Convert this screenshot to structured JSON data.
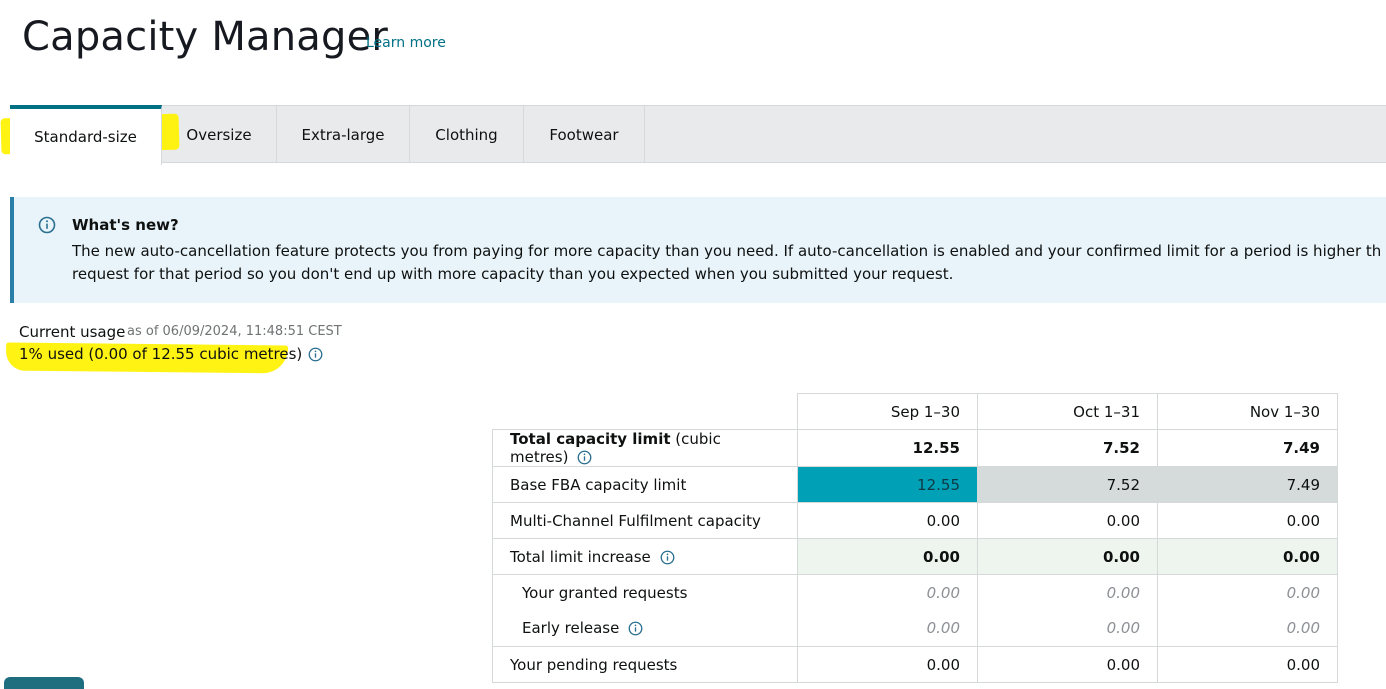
{
  "header": {
    "title": "Capacity Manager",
    "learn_more": "Learn more"
  },
  "tabs": [
    {
      "label": "Standard-size",
      "active": true
    },
    {
      "label": "Oversize",
      "active": false
    },
    {
      "label": "Extra-large",
      "active": false
    },
    {
      "label": "Clothing",
      "active": false
    },
    {
      "label": "Footwear",
      "active": false
    }
  ],
  "info": {
    "heading": "What's new?",
    "line1": "The new auto-cancellation feature protects you from paying for more capacity than you need. If auto-cancellation is enabled and your confirmed limit for a period is higher than estimat",
    "line2": "request for that period so you don't end up with more capacity than you expected when you submitted your request."
  },
  "usage": {
    "label": "Current usage",
    "as_of": "as of 06/09/2024, 11:48:51 CEST",
    "value": "1% used (0.00 of 12.55 cubic metres)"
  },
  "table": {
    "periods": [
      "Sep 1–30",
      "Oct 1–31",
      "Nov 1–30"
    ],
    "rows": {
      "total": {
        "label": "Total capacity limit",
        "unit": "(cubic metres)",
        "values": [
          "12.55",
          "7.52",
          "7.49"
        ]
      },
      "base": {
        "label": "Base FBA capacity limit",
        "values": [
          "12.55",
          "7.52",
          "7.49"
        ]
      },
      "mcf": {
        "label": "Multi-Channel Fulfilment capacity",
        "values": [
          "0.00",
          "0.00",
          "0.00"
        ]
      },
      "increase": {
        "label": "Total limit increase",
        "values": [
          "0.00",
          "0.00",
          "0.00"
        ]
      },
      "granted": {
        "label": "Your granted requests",
        "values": [
          "0.00",
          "0.00",
          "0.00"
        ]
      },
      "early": {
        "label": "Early release",
        "values": [
          "0.00",
          "0.00",
          "0.00"
        ]
      },
      "pending": {
        "label": "Your pending requests",
        "values": [
          "0.00",
          "0.00",
          "0.00"
        ]
      }
    }
  },
  "colors": {
    "accent": "#007185",
    "teal_cell": "#00a0b6",
    "highlight": "#fff200",
    "info_bg": "#e8f4fa"
  },
  "icons": {
    "info": "info-circle-icon"
  }
}
